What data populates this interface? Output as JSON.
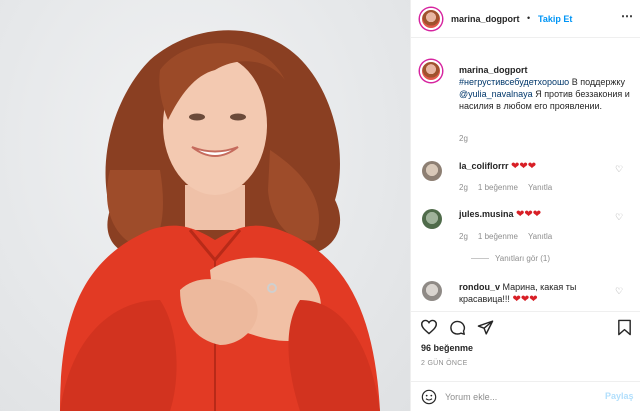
{
  "post": {
    "username": "marina_dogport",
    "follow_label": "Takip Et",
    "header_dot": "•",
    "caption_hashtag": "#негрустивсебудетхорошо",
    "caption_text_1": " В поддержку ",
    "caption_mention": "@yulia_navalnaya",
    "caption_text_2": " Я против беззакония и насилия в любом его проявлении.",
    "caption_time": "2g"
  },
  "comments": [
    {
      "username": "la_coliflorrr",
      "text": "",
      "hearts": "❤❤❤",
      "time": "2g",
      "likes": "1 beğenme",
      "reply": "Yanıtla"
    },
    {
      "username": "jules.musina",
      "text": "",
      "hearts": "❤❤❤",
      "time": "2g",
      "likes": "1 beğenme",
      "reply": "Yanıtla"
    },
    {
      "username": "rondou_v",
      "text": " Марина, какая ты красавица!!! ",
      "hearts": "❤❤❤"
    }
  ],
  "view_replies": "Yanıtları gör (1)",
  "likes_count": "96 beğenme",
  "time_ago": "2 GÜN ÖNCE",
  "comment_input": {
    "placeholder": "Yorum ekle...",
    "value": ""
  },
  "post_button": "Paylaş",
  "icons": {
    "more": "more-options-icon",
    "like": "heart-icon",
    "comment": "comment-bubble-icon",
    "share": "paper-plane-icon",
    "save": "bookmark-icon",
    "emoji": "smiley-icon"
  },
  "colors": {
    "link": "#00376b",
    "follow": "#0095f6",
    "heart": "#d81f26",
    "muted": "#8e8e8e"
  }
}
